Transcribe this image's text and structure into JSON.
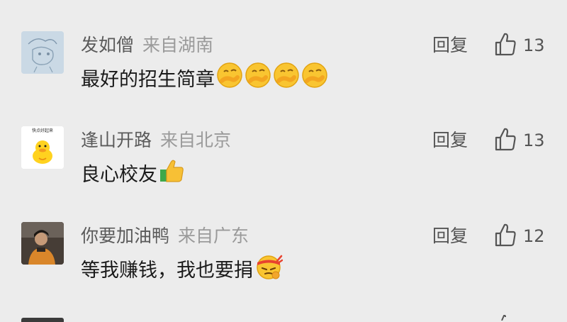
{
  "comments": [
    {
      "username": "发如僧",
      "location": "来自湖南",
      "text": "最好的招生简章",
      "reply_label": "回复",
      "likes": "13",
      "emojis": [
        "lip-smirk-emoji",
        "lip-smirk-emoji",
        "lip-smirk-emoji",
        "lip-smirk-emoji"
      ]
    },
    {
      "username": "逢山开路",
      "location": "来自北京",
      "text": "良心校友",
      "reply_label": "回复",
      "likes": "13",
      "emojis": [
        "thumbs-up-emoji"
      ],
      "avatar_text": "快点好起来"
    },
    {
      "username": "你要加油鸭",
      "location": "来自广东",
      "text": "等我赚钱，我也要捐",
      "reply_label": "回复",
      "likes": "12",
      "emojis": [
        "determined-headband-emoji"
      ]
    }
  ],
  "colors": {
    "background": "#ececec",
    "username": "#5a5a5a",
    "location": "#9a9a9a",
    "text": "#1a1a1a"
  }
}
